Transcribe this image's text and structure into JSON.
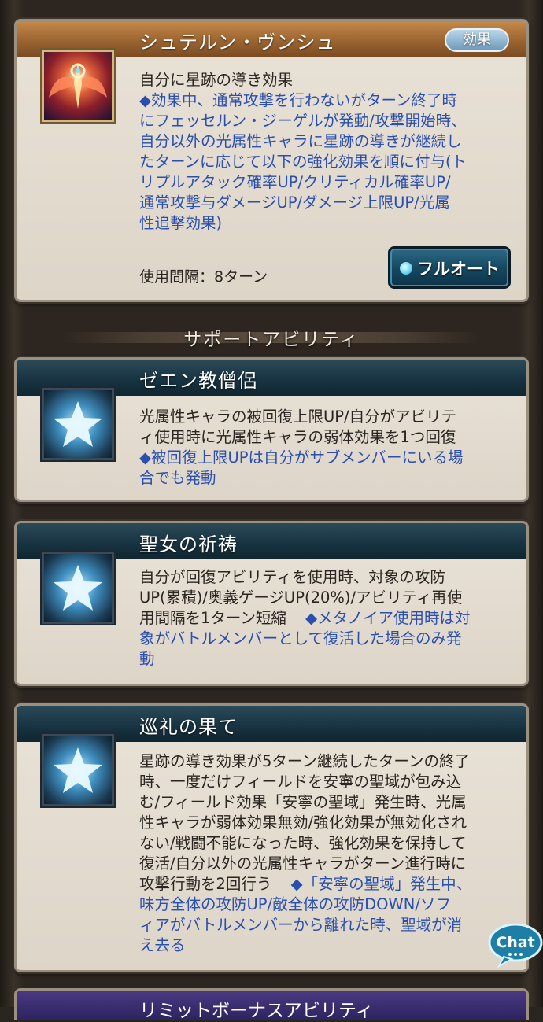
{
  "skill": {
    "title": "シュテルン・ヴンシュ",
    "badge": "効果",
    "line1": "自分に星跡の導き効果",
    "desc_lines": [
      "◆効果中、通常攻撃を行わないがターン終了時",
      "にフェッセルン・ジーゲルが発動/攻撃開始時、",
      "自分以外の光属性キャラに星跡の導きが継続し",
      "たターンに応じて以下の強化効果を順に付与(ト",
      "リプルアタック確率UP/クリティカル確率UP/",
      "通常攻撃与ダメージUP/ダメージ上限UP/光属",
      "性追撃効果)"
    ],
    "usage": "使用間隔：8ターン",
    "fullauto_label": "フルオート",
    "icon": "winged-key-icon"
  },
  "section_label": "サポートアビリティ",
  "support": [
    {
      "title": "ゼエン教僧侶",
      "icon": "star-icon",
      "black_lines": [
        "光属性キャラの被回復上限UP/自分がアビリテ",
        "ィ使用時に光属性キャラの弱体効果を1つ回復"
      ],
      "blue_lines": [
        "◆被回復上限UPは自分がサブメンバーにいる場",
        "合でも発動"
      ]
    },
    {
      "title": "聖女の祈祷",
      "icon": "star-icon",
      "black_lines": [
        "自分が回復アビリティを使用時、対象の攻防",
        "UP(累積)/奥義ゲージUP(20%)/アビリティ再使",
        "用間隔を1ターン短縮"
      ],
      "blue_inline": "◆メタノイア使用時は対",
      "blue_lines": [
        "象がバトルメンバーとして復活した場合のみ発",
        "動"
      ]
    },
    {
      "title": "巡礼の果て",
      "icon": "star-icon",
      "black_lines": [
        "星跡の導き効果が5ターン継続したターンの終了",
        "時、一度だけフィールドを安寧の聖域が包み込",
        "む/フィールド効果「安寧の聖域」発生時、光属",
        "性キャラが弱体効果無効/強化効果が無効化され",
        "ない/戦闘不能になった時、強化効果を保持して",
        "復活/自分以外の光属性キャラがターン進行時に",
        "攻撃行動を2回行う"
      ],
      "blue_inline": "◆「安寧の聖域」発生中、",
      "blue_lines": [
        "味方全体の攻防UP/敵全体の攻防DOWN/ソフ",
        "ィアがバトルメンバーから離れた時、聖域が消",
        "え去る"
      ]
    }
  ],
  "bottom_cut_title": "リミットボーナスアビリティ",
  "chat_label": "Chat"
}
